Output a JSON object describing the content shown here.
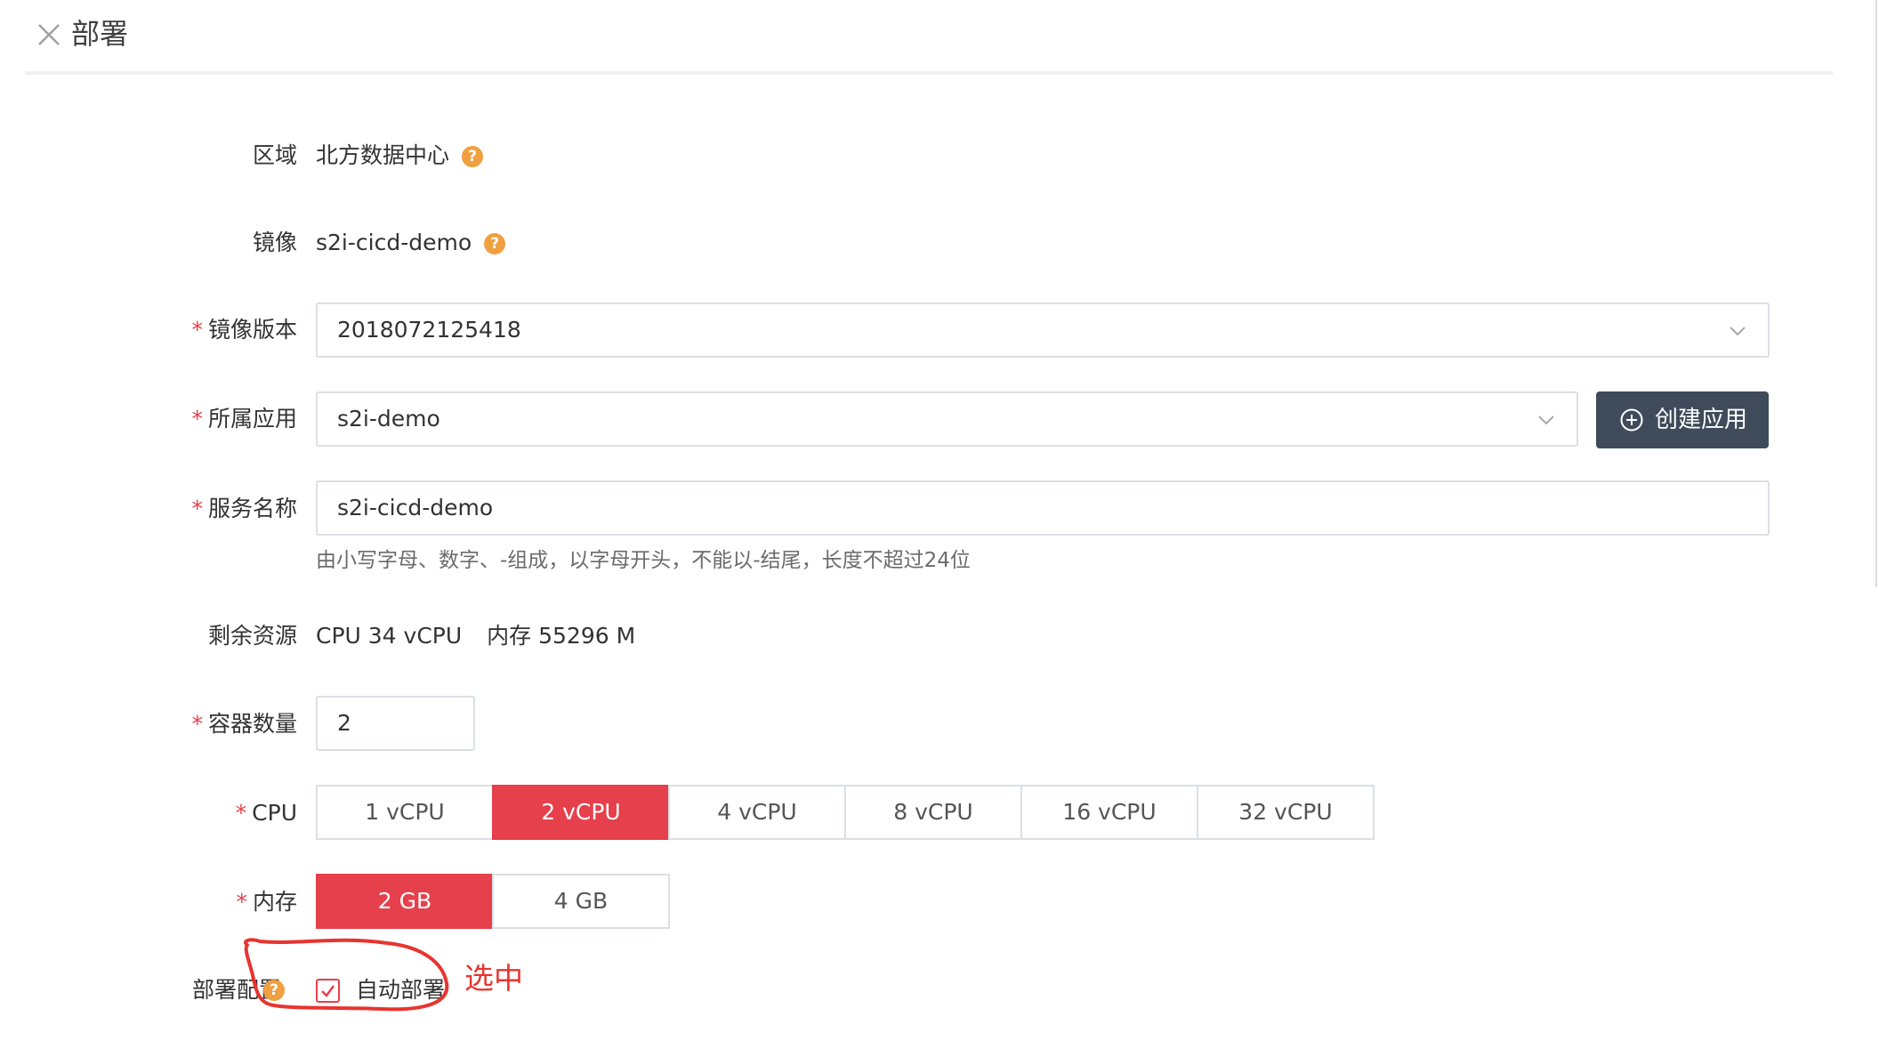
{
  "header": {
    "title": "部署",
    "close_icon": "close-icon"
  },
  "form": {
    "region": {
      "label": "区域",
      "value": "北方数据中心",
      "help": "?"
    },
    "image": {
      "label": "镜像",
      "value": "s2i-cicd-demo",
      "help": "?"
    },
    "image_version": {
      "required": "*",
      "label": "镜像版本",
      "value": "2018072125418"
    },
    "app": {
      "required": "*",
      "label": "所属应用",
      "value": "s2i-demo",
      "create_label": "创建应用"
    },
    "service_name": {
      "required": "*",
      "label": "服务名称",
      "value": "s2i-cicd-demo",
      "hint": "由小写字母、数字、-组成，以字母开头，不能以-结尾，长度不超过24位"
    },
    "resources": {
      "label": "剩余资源",
      "cpu": "CPU 34 vCPU",
      "memory": "内存 55296 M"
    },
    "replicas": {
      "required": "*",
      "label": "容器数量",
      "value": "2"
    },
    "cpu": {
      "required": "*",
      "label": "CPU",
      "options": [
        "1 vCPU",
        "2 vCPU",
        "4 vCPU",
        "8 vCPU",
        "16 vCPU",
        "32 vCPU"
      ],
      "selected": "2 vCPU"
    },
    "memory": {
      "required": "*",
      "label": "内存",
      "options": [
        "2 GB",
        "4 GB"
      ],
      "selected": "2 GB"
    },
    "deploy_config": {
      "label": "部署配置",
      "help": "?",
      "checkbox_label": "自动部署",
      "checked": true
    }
  },
  "annotation": {
    "text": "选中"
  },
  "colors": {
    "accent": "#e5404b",
    "button_dark": "#3f4b5a",
    "help_orange": "#f0a040",
    "annotation_red": "#e8342f"
  }
}
